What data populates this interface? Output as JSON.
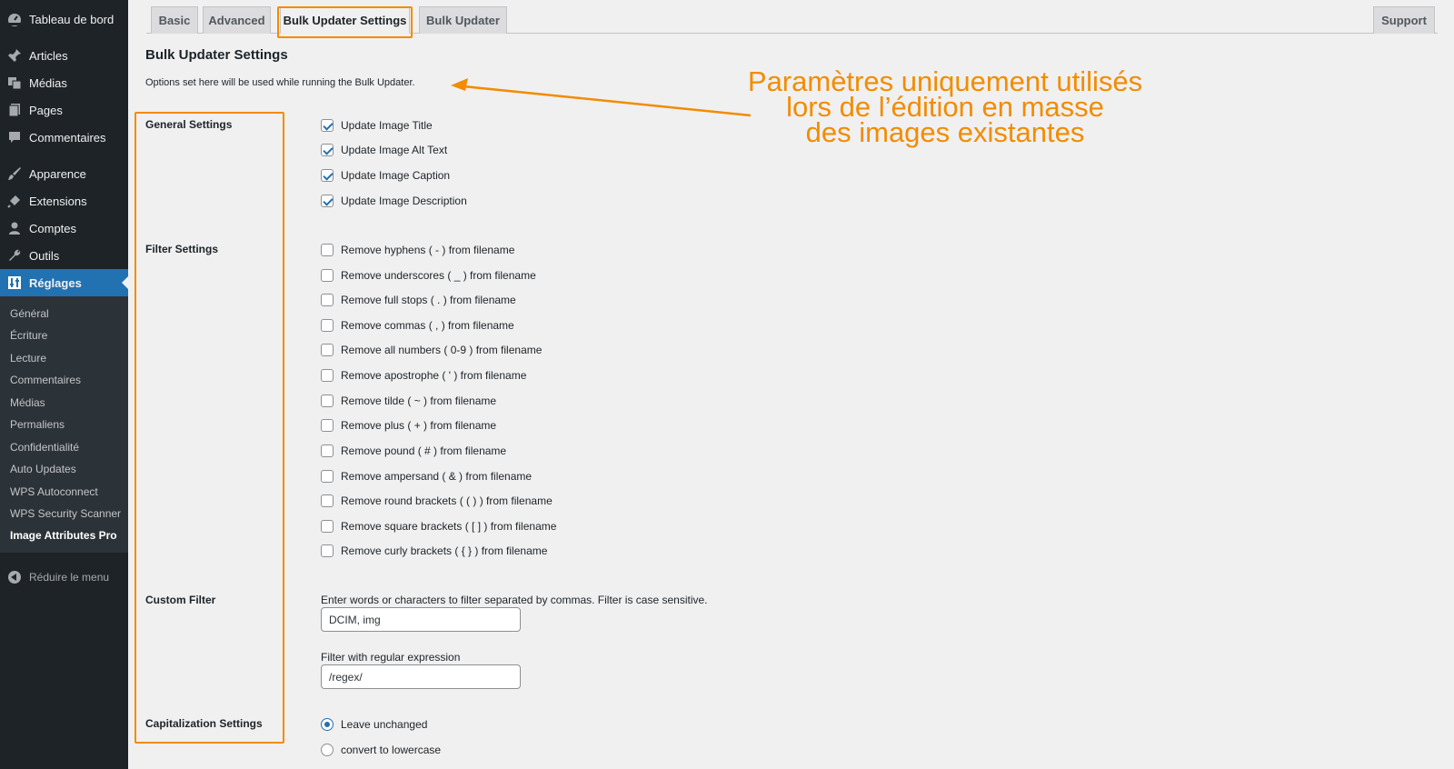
{
  "sidebar": {
    "items": [
      {
        "label": "Tableau de bord",
        "icon": "dashboard-icon"
      },
      {
        "label": "Articles",
        "icon": "pin-icon"
      },
      {
        "label": "Médias",
        "icon": "media-icon"
      },
      {
        "label": "Pages",
        "icon": "page-icon"
      },
      {
        "label": "Commentaires",
        "icon": "comment-icon"
      },
      {
        "label": "Apparence",
        "icon": "brush-icon"
      },
      {
        "label": "Extensions",
        "icon": "plugin-icon"
      },
      {
        "label": "Comptes",
        "icon": "user-icon"
      },
      {
        "label": "Outils",
        "icon": "wrench-icon"
      },
      {
        "label": "Réglages",
        "icon": "settings-icon"
      }
    ],
    "submenu": [
      "Général",
      "Écriture",
      "Lecture",
      "Commentaires",
      "Médias",
      "Permaliens",
      "Confidentialité",
      "Auto Updates",
      "WPS Autoconnect",
      "WPS Security Scanner",
      "Image Attributes Pro"
    ],
    "collapse_label": "Réduire le menu"
  },
  "tabs": [
    "Basic",
    "Advanced",
    "Bulk Updater Settings",
    "Bulk Updater"
  ],
  "support_label": "Support",
  "page": {
    "title": "Bulk Updater Settings",
    "description": "Options set here will be used while running the Bulk Updater."
  },
  "general": {
    "label": "General Settings",
    "options": [
      "Update Image Title",
      "Update Image Alt Text",
      "Update Image Caption",
      "Update Image Description"
    ]
  },
  "filter": {
    "label": "Filter Settings",
    "options": [
      "Remove hyphens ( - ) from filename",
      "Remove underscores ( _ ) from filename",
      "Remove full stops ( . ) from filename",
      "Remove commas ( , ) from filename",
      "Remove all numbers ( 0-9 ) from filename",
      "Remove apostrophe ( ' ) from filename",
      "Remove tilde ( ~ ) from filename",
      "Remove plus ( + ) from filename",
      "Remove pound ( # ) from filename",
      "Remove ampersand ( & ) from filename",
      "Remove round brackets ( ( ) ) from filename",
      "Remove square brackets ( [ ] ) from filename",
      "Remove curly brackets ( { } ) from filename"
    ]
  },
  "custom_filter": {
    "label": "Custom Filter",
    "help": "Enter words or characters to filter separated by commas. Filter is case sensitive.",
    "value": "DCIM, img",
    "regex_label": "Filter with regular expression",
    "regex_value": "/regex/"
  },
  "capitalization": {
    "label": "Capitalization Settings",
    "options": [
      "Leave unchanged",
      "convert to lowercase"
    ]
  },
  "annotation": {
    "lines": [
      "Paramètres uniquement utilisés",
      "lors de l’édition en masse",
      "des images existantes"
    ],
    "color": "#f28c00"
  },
  "colors": {
    "accent": "#2271b1",
    "sidebar": "#1d2327",
    "highlight": "#f28c00"
  }
}
